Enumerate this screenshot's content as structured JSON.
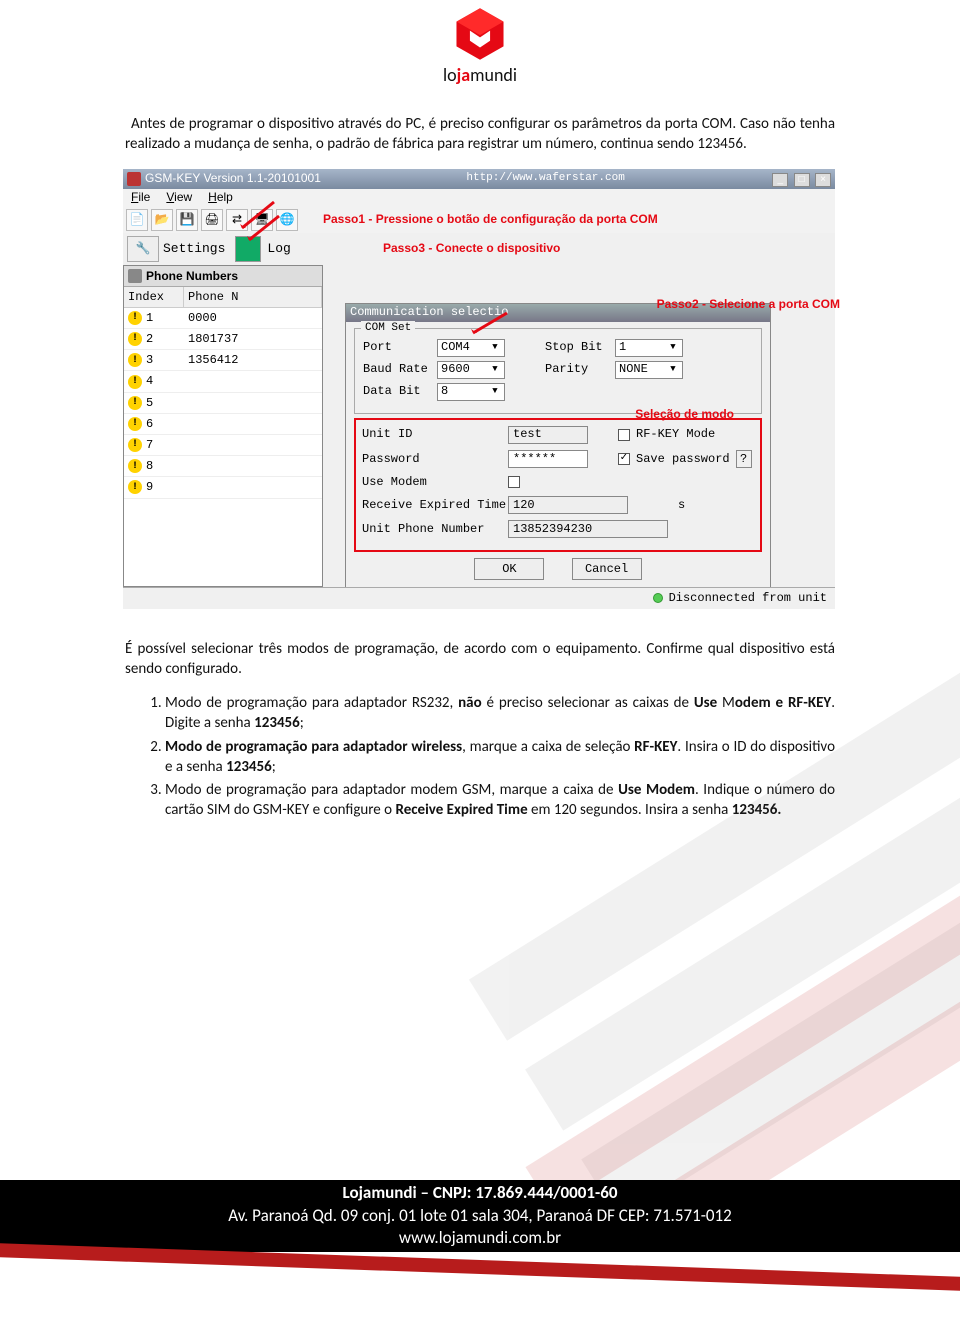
{
  "header": {
    "brand_lo": "lo",
    "brand_ja": "ja",
    "brand_mundi": "mundi"
  },
  "intro": "Antes de programar o dispositivo através do PC, é preciso configurar os parâmetros da porta COM. Caso não tenha realizado a mudança de senha, o padrão de fábrica para registrar um número, continua sendo 123456.",
  "after": "É possível selecionar três modos de programação, de acordo com o equipamento. Confirme qual dispositivo está sendo configurado.",
  "list": [
    "Modo de programação para adaptador RS232, <strong>não</strong> é preciso selecionar as caixas de <strong>Use</strong> M<strong>odem e RF-KEY</strong>. Digite a senha <strong>123456</strong>;",
    "<strong>Modo de programação para adaptador wireless</strong>, marque a caixa de seleção <strong>RF-KEY</strong>. Insira o ID do dispositivo e a senha <strong>123456</strong>;",
    "Modo de programação para adaptador modem GSM, marque a caixa de <strong>Use Modem</strong>. Indique o número do cartão SIM do GSM-KEY e configure o <strong>Receive Expired Time</strong> em 120 segundos. Insira a senha <strong>123456.</strong>"
  ],
  "screenshot": {
    "title_left": "GSM-KEY Version 1.1-20101001",
    "title_right": "http://www.waferstar.com",
    "menu": [
      "File",
      "View",
      "Help"
    ],
    "steps": {
      "s1": "Passo1 - Pressione o botão de configuração da porta COM",
      "s2": "Passo2 - Selecione a porta COM",
      "s3": "Passo3 - Conecte o dispositivo",
      "mode": "Seleção de modo"
    },
    "settings_label": "Settings",
    "log_label": "Log",
    "phone_header": "Phone Numbers",
    "phone_cols": {
      "c1": "Index",
      "c2": "Phone N"
    },
    "phone_rows": [
      {
        "idx": "1",
        "num": "0000"
      },
      {
        "idx": "2",
        "num": "1801737"
      },
      {
        "idx": "3",
        "num": "1356412"
      },
      {
        "idx": "4",
        "num": ""
      },
      {
        "idx": "5",
        "num": ""
      },
      {
        "idx": "6",
        "num": ""
      },
      {
        "idx": "7",
        "num": ""
      },
      {
        "idx": "8",
        "num": ""
      },
      {
        "idx": "9",
        "num": ""
      }
    ],
    "dialog": {
      "title": "Communication selectio",
      "comset_legend": "COM Set",
      "port_lbl": "Port",
      "port_val": "COM4",
      "baud_lbl": "Baud Rate",
      "baud_val": "9600",
      "data_lbl": "Data Bit",
      "data_val": "8",
      "stop_lbl": "Stop Bit",
      "stop_val": "1",
      "parity_lbl": "Parity",
      "parity_val": "NONE",
      "unitid_lbl": "Unit ID",
      "unitid_val": "test",
      "pwd_lbl": "Password",
      "pwd_val": "******",
      "rfkey_lbl": "RF-KEY Mode",
      "savepwd_lbl": "Save password",
      "help_btn": "?",
      "modem_lbl": "Use Modem",
      "rexp_lbl": "Receive Expired Time",
      "rexp_val": "120",
      "rexp_unit": "s",
      "uphone_lbl": "Unit Phone Number",
      "uphone_val": "13852394230",
      "ok": "OK",
      "cancel": "Cancel"
    },
    "status": "Disconnected from unit"
  },
  "footer": {
    "l1": "Lojamundi – CNPJ: 17.869.444/0001-60",
    "l2": "Av. Paranoá Qd. 09 conj. 01 lote 01 sala 304, Paranoá DF CEP: 71.571-012",
    "l3": "www.lojamundi.com.br"
  }
}
